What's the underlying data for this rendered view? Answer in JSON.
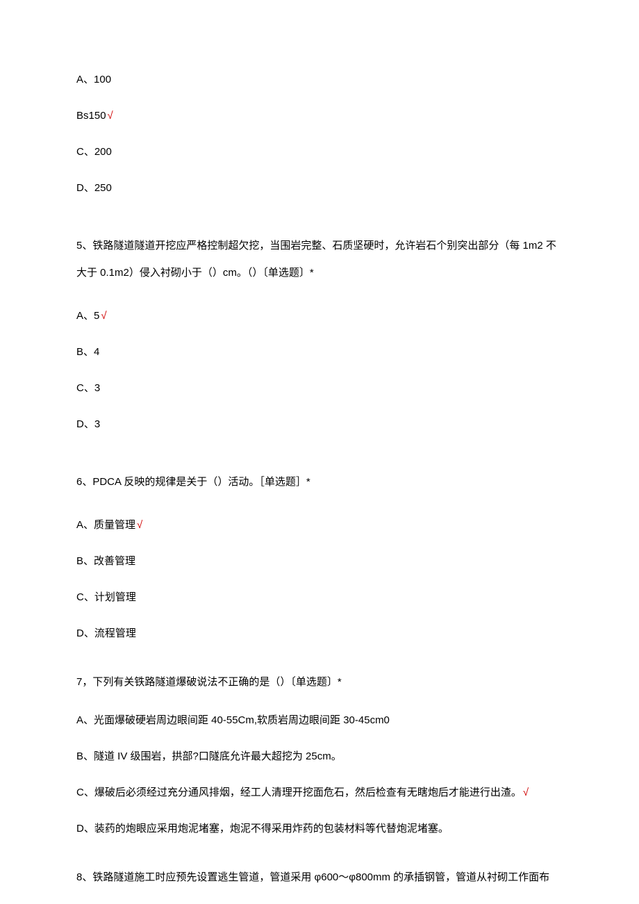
{
  "q4": {
    "options": {
      "a": "A、100",
      "b": "Bs150",
      "c": "C、200",
      "d": "D、250"
    },
    "correct_mark": "√"
  },
  "q5": {
    "stem": "5、铁路隧道隧道开挖应严格控制超欠挖，当围岩完整、石质坚硬时，允许岩石个别突出部分（每 1m2 不大于 0.1m2）侵入衬砌小于（）cm。（）〔单选题〕*",
    "options": {
      "a": "A、5",
      "b": "B、4",
      "c": "C、3",
      "d": "D、3"
    },
    "correct_mark": "√"
  },
  "q6": {
    "stem": "6、PDCA 反映的规律是关于（）活动。［单选题］*",
    "options": {
      "a": "A、质量管理",
      "b": "B、改善管理",
      "c": "C、计划管理",
      "d": "D、流程管理"
    },
    "correct_mark": "√"
  },
  "q7": {
    "stem": "7，下列有关铁路隧道爆破说法不正确的是（）〔单选题〕*",
    "options": {
      "a": "A、光面爆破硬岩周边眼间距 40-55Cm,软质岩周边眼间距 30-45cm0",
      "b": "B、隧道 IV 级围岩，拱部?口隧底允许最大超挖为 25cm。",
      "c": "C、爆破后必须经过充分通风排烟，经工人清理开挖面危石，然后检查有无瞎炮后才能进行出渣。",
      "d": "D、装药的炮眼应采用炮泥堵塞，炮泥不得采用炸药的包装材料等代替炮泥堵塞。"
    },
    "correct_mark": "√"
  },
  "q8": {
    "stem": "8、铁路隧道施工时应预先设置逃生管道，管道采用 φ600～φ800mm 的承插钢管，管道从衬砌工作面布"
  }
}
